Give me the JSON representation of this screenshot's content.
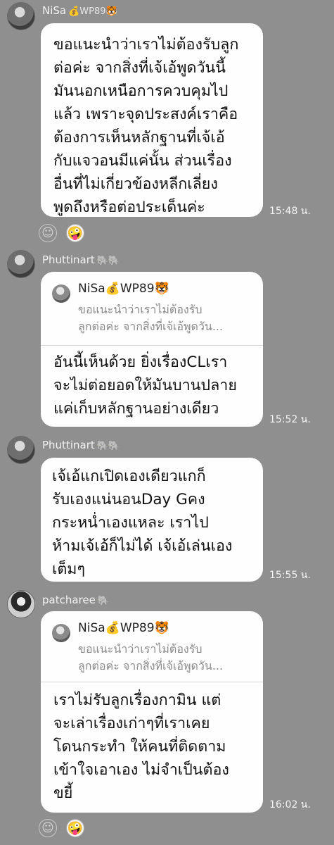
{
  "messages": [
    {
      "sender": "NiSa",
      "sender_suffix": "💰WP89🐯",
      "text": "ขอแนะนำว่าเราไม่ต้องรับลูก\nต่อค่ะ จากสิ่งที่เจ้เอ้พูดวันนี้\nมันนอกเหนือการควบคุมไป\nแล้ว เพราะจุดประสงค์เราคือ\nต้องการเห็นหลักฐานที่เจ้เอ้\nกับแจวอนมีแค่นั้น ส่วนเรื่อง\nอื่นที่ไม่เกี่ยวข้องหลีกเลี่ยง\nพูดถึงหรือต่อประเด็นค่ะ",
      "time": "15:48 น."
    },
    {
      "sender": "Phuttinart",
      "sender_suffix": "🐘🐘",
      "reply_name": "NiSa💰WP89🐯",
      "reply_text": "ขอแนะนำว่าเราไม่ต้องรับ\nลูกต่อค่ะ จากสิ่งที่เจ้เอ้พูดวัน...",
      "text": "อันนี้เห็นด้วย ยิ่งเรื่องCLเรา\nจะไม่ต่อยอดให้มันบานปลาย\nแค่เก็บหลักฐานอย่างเดียว",
      "time": "15:52 น."
    },
    {
      "sender": "Phuttinart",
      "sender_suffix": "🐘🐘",
      "text": "เจ้เอ้แกเปิดเองเดียวแกก็\nรับเองแน่นอนDay Gคง\nกระหน่ำเองแหละ เราไป\nห้ามเจ้เอ้ก็ไม่ได้ เจ้เอ้เล่นเอง\nเต็มๆ",
      "time": "15:55 น."
    },
    {
      "sender": "patcharee",
      "sender_suffix": "🐘",
      "reply_name": "NiSa💰WP89🐯",
      "reply_text": "ขอแนะนำว่าเราไม่ต้องรับ\nลูกต่อค่ะ จากสิ่งที่เจ้เอ้พูดวัน...",
      "text": "เราไม่รับลูกเรื่องกามิน แต่\nจะเล่าเรื่องเก่าๆที่เราเคย\nโดนกระทำ ให้คนที่ติดตาม\nเข้าใจเอาเอง ไม่จำเป็นต้อง\nขยี้",
      "time": "16:02 น."
    }
  ],
  "icons": {
    "smile": "☺",
    "face": "🤪"
  },
  "colors": {
    "background": "#8f8f8f",
    "bubble": "#fefefe"
  }
}
